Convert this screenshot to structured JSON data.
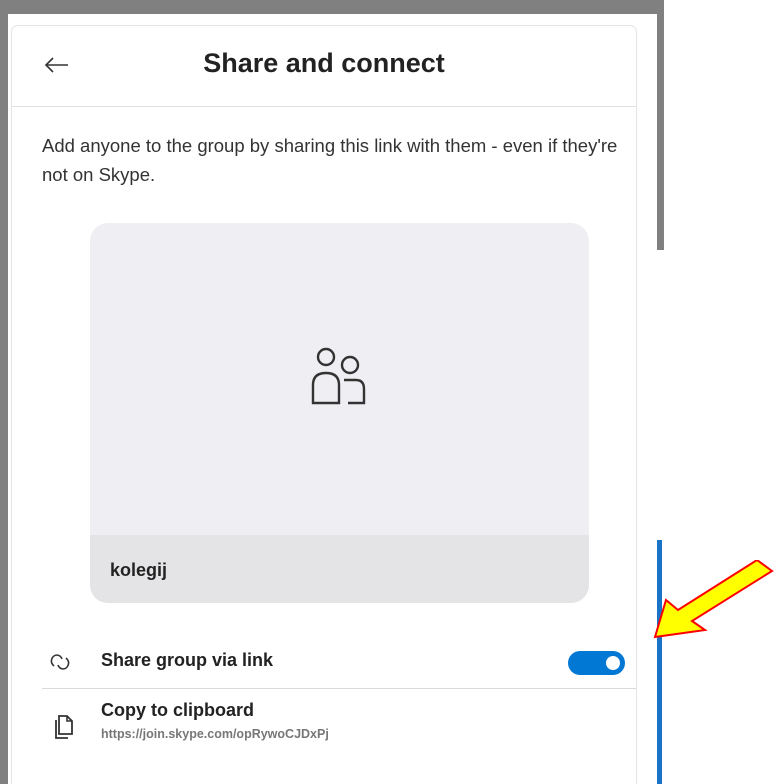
{
  "dialog": {
    "title": "Share and connect",
    "description": "Add anyone to the group by sharing this link with them - even if they're not on Skype."
  },
  "group_card": {
    "name": "kolegij",
    "avatar_icon": "people-icon"
  },
  "share_link": {
    "label": "Share group via link",
    "icon": "link-icon",
    "enabled": true
  },
  "copy_clipboard": {
    "label": "Copy to clipboard",
    "url": "https://join.skype.com/opRywoCJDxPj",
    "icon": "copy-icon"
  },
  "colors": {
    "toggle_on": "#0078d4",
    "card_bg": "#efeff3",
    "card_footer_bg": "#e4e4e7",
    "annotation_arrow_fill": "#ffff00",
    "annotation_arrow_stroke": "#ff0000"
  }
}
